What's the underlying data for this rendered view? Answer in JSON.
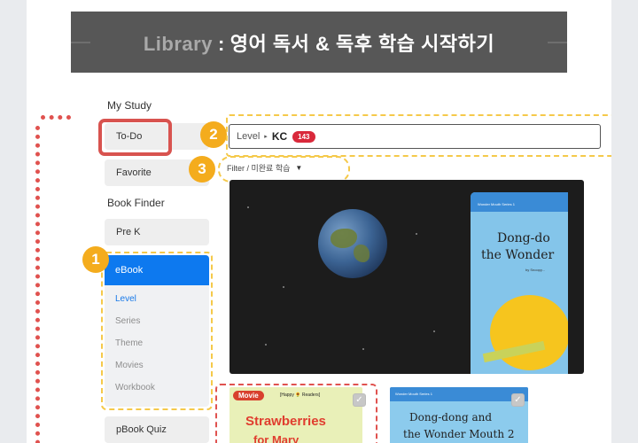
{
  "banner": {
    "library": "Library",
    "colon": ":",
    "subtitle": "영어 독서 & 독후 학습 시작하기"
  },
  "sidebar": {
    "my_study_label": "My Study",
    "todo_label": "To-Do",
    "favorite_label": "Favorite",
    "book_finder_label": "Book Finder",
    "prek_label": "Pre K",
    "ebook_label": "eBook",
    "ebook_items": [
      {
        "label": "Level",
        "active": true
      },
      {
        "label": "Series",
        "active": false
      },
      {
        "label": "Theme",
        "active": false
      },
      {
        "label": "Movies",
        "active": false
      },
      {
        "label": "Workbook",
        "active": false
      }
    ],
    "pbook_quiz_label": "pBook Quiz"
  },
  "badges": [
    "1",
    "2",
    "3"
  ],
  "breadcrumb": {
    "level": "Level",
    "arrow": "▸",
    "current": "KC",
    "count": "143"
  },
  "filter": {
    "label": "Filter / 미완료 학습",
    "caret": "▼"
  },
  "featured_book": {
    "series": "Wonder Mouth Series 1",
    "title_line1": "Dong-do",
    "title_line2": "the Wonder",
    "author": "by Snoopy..."
  },
  "cards": [
    {
      "tag": "Movie",
      "series": "[Happy 🌻 Readers]",
      "title_line1": "Strawberries",
      "title_line2": "for Mary",
      "check": "✓"
    },
    {
      "series": "Wonder Mouth Series 1",
      "title_line1": "Dong-dong and",
      "title_line2": "the Wonder Mouth 2",
      "check": "✓"
    }
  ],
  "colors": {
    "banner_bg": "#575757",
    "accent_blue": "#0d79ef",
    "highlight_red": "#d8534f",
    "badge_orange": "#f4ac1d",
    "dashed_yellow": "#f5c94a",
    "count_badge_red": "#d9293b"
  }
}
